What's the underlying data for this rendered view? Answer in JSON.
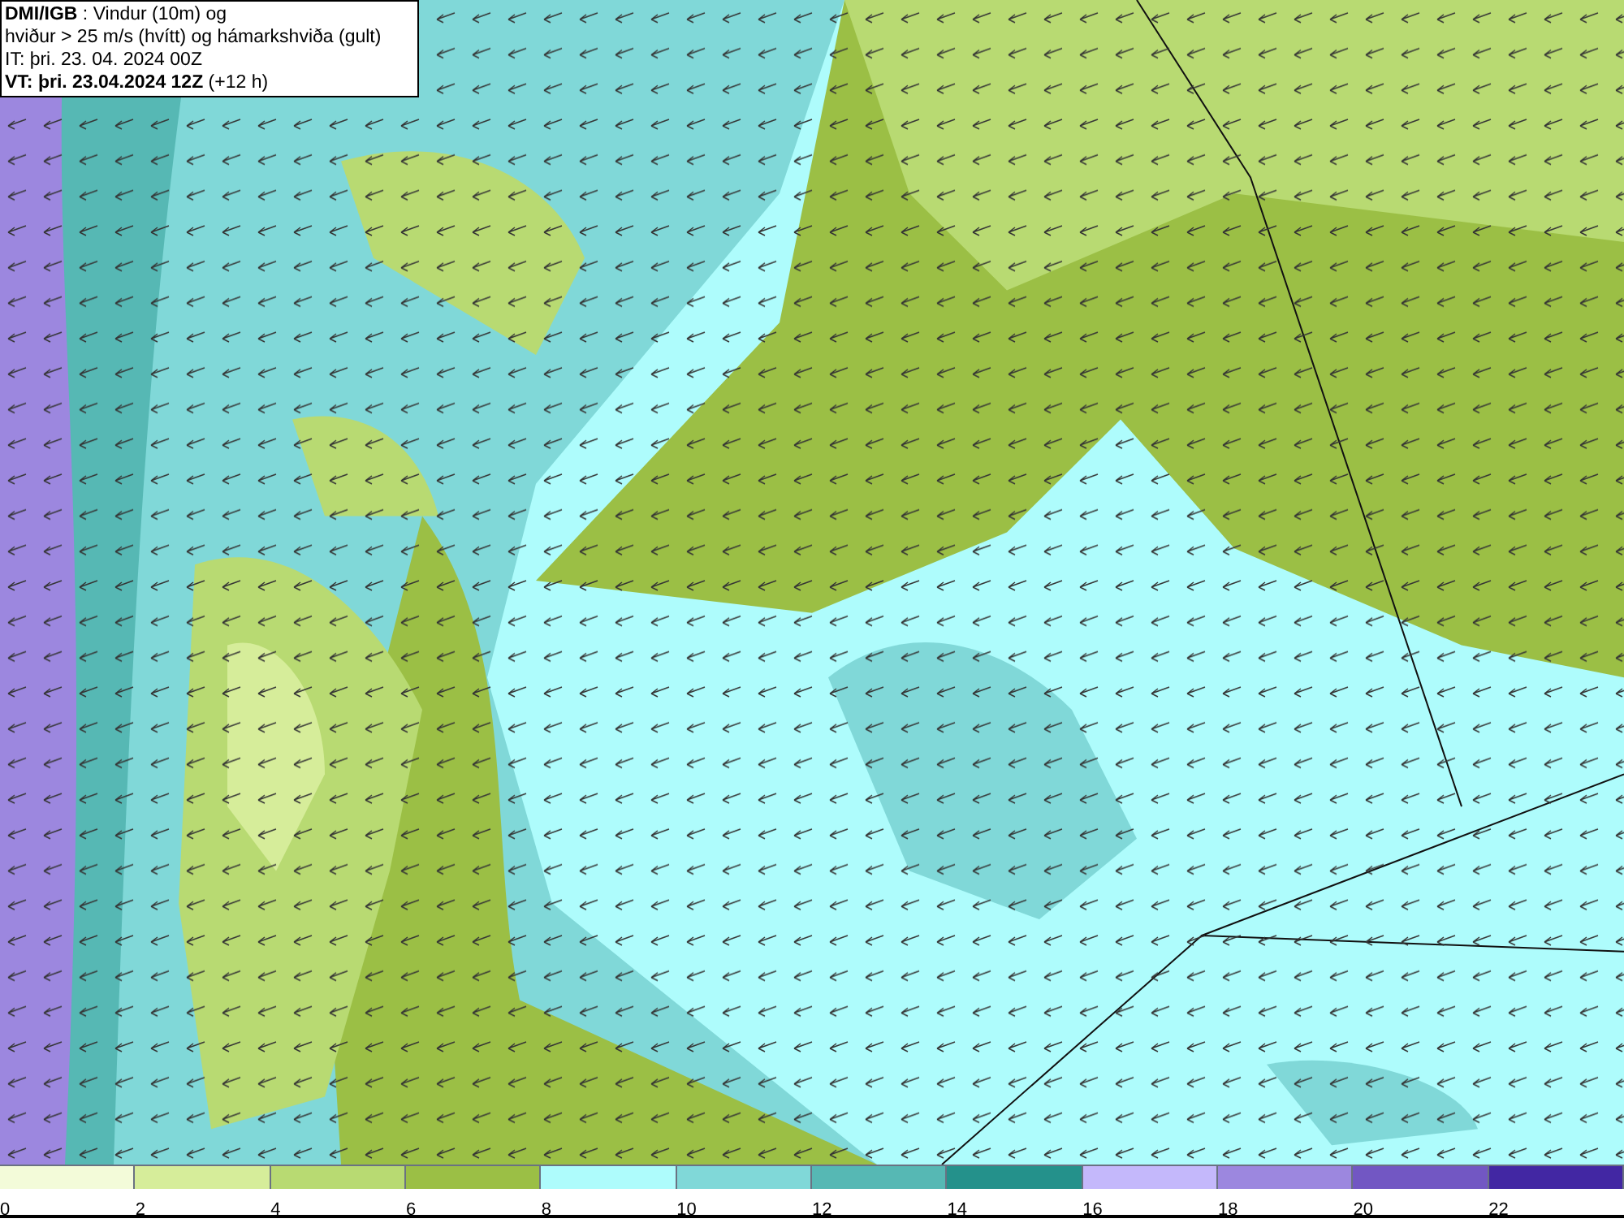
{
  "title_box": {
    "lines": [
      "**DMI/IGB** : Vindur (10m) og",
      "hviður > 25 m/s (hvítt) og hámarkshviða (gult)",
      "IT: þri. 23. 04. 2024 00Z",
      "**VT: þri. 23.04.2024 12Z** (+12 h)"
    ]
  },
  "legend": [
    {
      "label": "0",
      "color": "#f3fbd9"
    },
    {
      "label": "2",
      "color": "#d6ed9a"
    },
    {
      "label": "4",
      "color": "#b8da72"
    },
    {
      "label": "6",
      "color": "#9bbf45"
    },
    {
      "label": "8",
      "color": "#aefcfc"
    },
    {
      "label": "10",
      "color": "#80d8d8"
    },
    {
      "label": "12",
      "color": "#56b8b4"
    },
    {
      "label": "14",
      "color": "#24918b"
    },
    {
      "label": "16",
      "color": "#c4b8fb"
    },
    {
      "label": "18",
      "color": "#9c87df"
    },
    {
      "label": "20",
      "color": "#7257c3"
    },
    {
      "label": "22",
      "color": "#4227a3"
    }
  ]
}
